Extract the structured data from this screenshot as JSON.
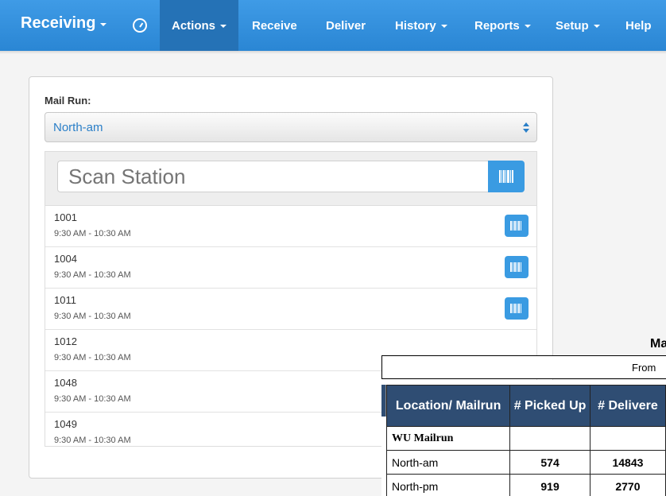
{
  "navbar": {
    "brand": "Receiving",
    "items": [
      {
        "label": "Actions",
        "dropdown": true,
        "active": true
      },
      {
        "label": "Receive",
        "dropdown": false
      },
      {
        "label": "Deliver",
        "dropdown": false
      },
      {
        "label": "History",
        "dropdown": true
      },
      {
        "label": "Reports",
        "dropdown": true
      },
      {
        "label": "Setup",
        "dropdown": true
      },
      {
        "label": "Help",
        "dropdown": false
      }
    ],
    "icons": [
      "clock-icon",
      "caret-down-icon"
    ]
  },
  "form": {
    "mail_run_label": "Mail Run:",
    "mail_run_value": "North-am",
    "scan_placeholder": "Scan Station",
    "stations": [
      {
        "number": "1001",
        "time": "9:30 AM - 10:30 AM"
      },
      {
        "number": "1004",
        "time": "9:30 AM - 10:30 AM"
      },
      {
        "number": "1011",
        "time": "9:30 AM - 10:30 AM"
      },
      {
        "number": "1012",
        "time": "9:30 AM - 10:30 AM"
      },
      {
        "number": "1048",
        "time": "9:30 AM - 10:30 AM"
      },
      {
        "number": "1049",
        "time": "9:30 AM - 10:30 AM"
      }
    ]
  },
  "report": {
    "title": "Mailru",
    "from_label": "From",
    "headers": [
      "Location/ Mailrun",
      "# Picked Up",
      "# Delivere"
    ],
    "group": "WU Mailrun",
    "rows": [
      {
        "location": "North-am",
        "picked_up": "574",
        "delivered": "14843"
      },
      {
        "location": "North-pm",
        "picked_up": "919",
        "delivered": "2770"
      }
    ]
  },
  "colors": {
    "navbar": "#2a86d4",
    "navbar_active": "#2572b6",
    "button": "#3a9be2",
    "table_header": "#2f4d73"
  }
}
